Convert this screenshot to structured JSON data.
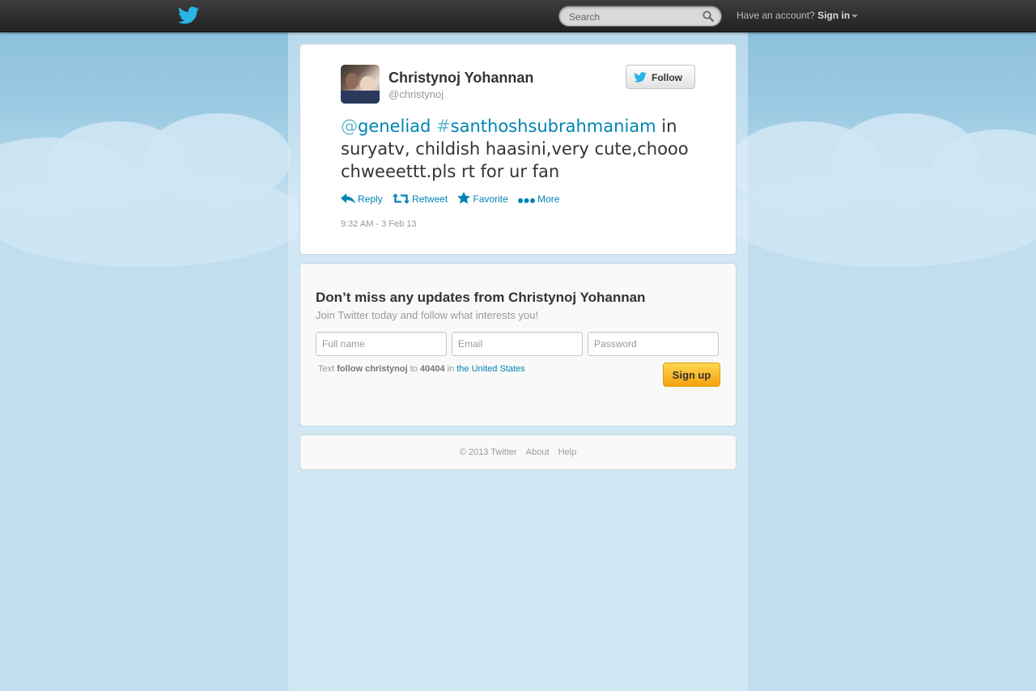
{
  "topbar": {
    "search_placeholder": "Search",
    "account_prompt": "Have an account?",
    "signin_label": "Sign in"
  },
  "tweet": {
    "author_name": "Christynoj Yohannan",
    "screen_name": "@christynoj",
    "follow_label": "Follow",
    "mention_symbol": "@",
    "mention_text": "geneliad",
    "hashtag_symbol": "#",
    "hashtag_text": "santhoshsubrahmaniam",
    "body_text": " in suryatv, childish haasini,very cute,chooo chweeettt.pls rt for ur fan",
    "actions": {
      "reply": "Reply",
      "retweet": "Retweet",
      "favorite": "Favorite",
      "more": "More"
    },
    "timestamp": "9:32 AM - 3 Feb 13"
  },
  "signup": {
    "title": "Don’t miss any updates from Christynoj Yohannan",
    "subtitle": "Join Twitter today and follow what interests you!",
    "fullname_placeholder": "Full name",
    "email_placeholder": "Email",
    "password_placeholder": "Password",
    "sms_prefix": "Text",
    "sms_command": "follow christynoj",
    "sms_to": "to",
    "sms_number": "40404",
    "sms_in": "in",
    "sms_country": "the United States",
    "button_label": "Sign up"
  },
  "footer": {
    "copyright": "© 2013 Twitter",
    "about": "About",
    "help": "Help"
  },
  "colors": {
    "link": "#0084b4",
    "signup_button": "#f7a10d",
    "topbar": "#2d2d2d"
  }
}
